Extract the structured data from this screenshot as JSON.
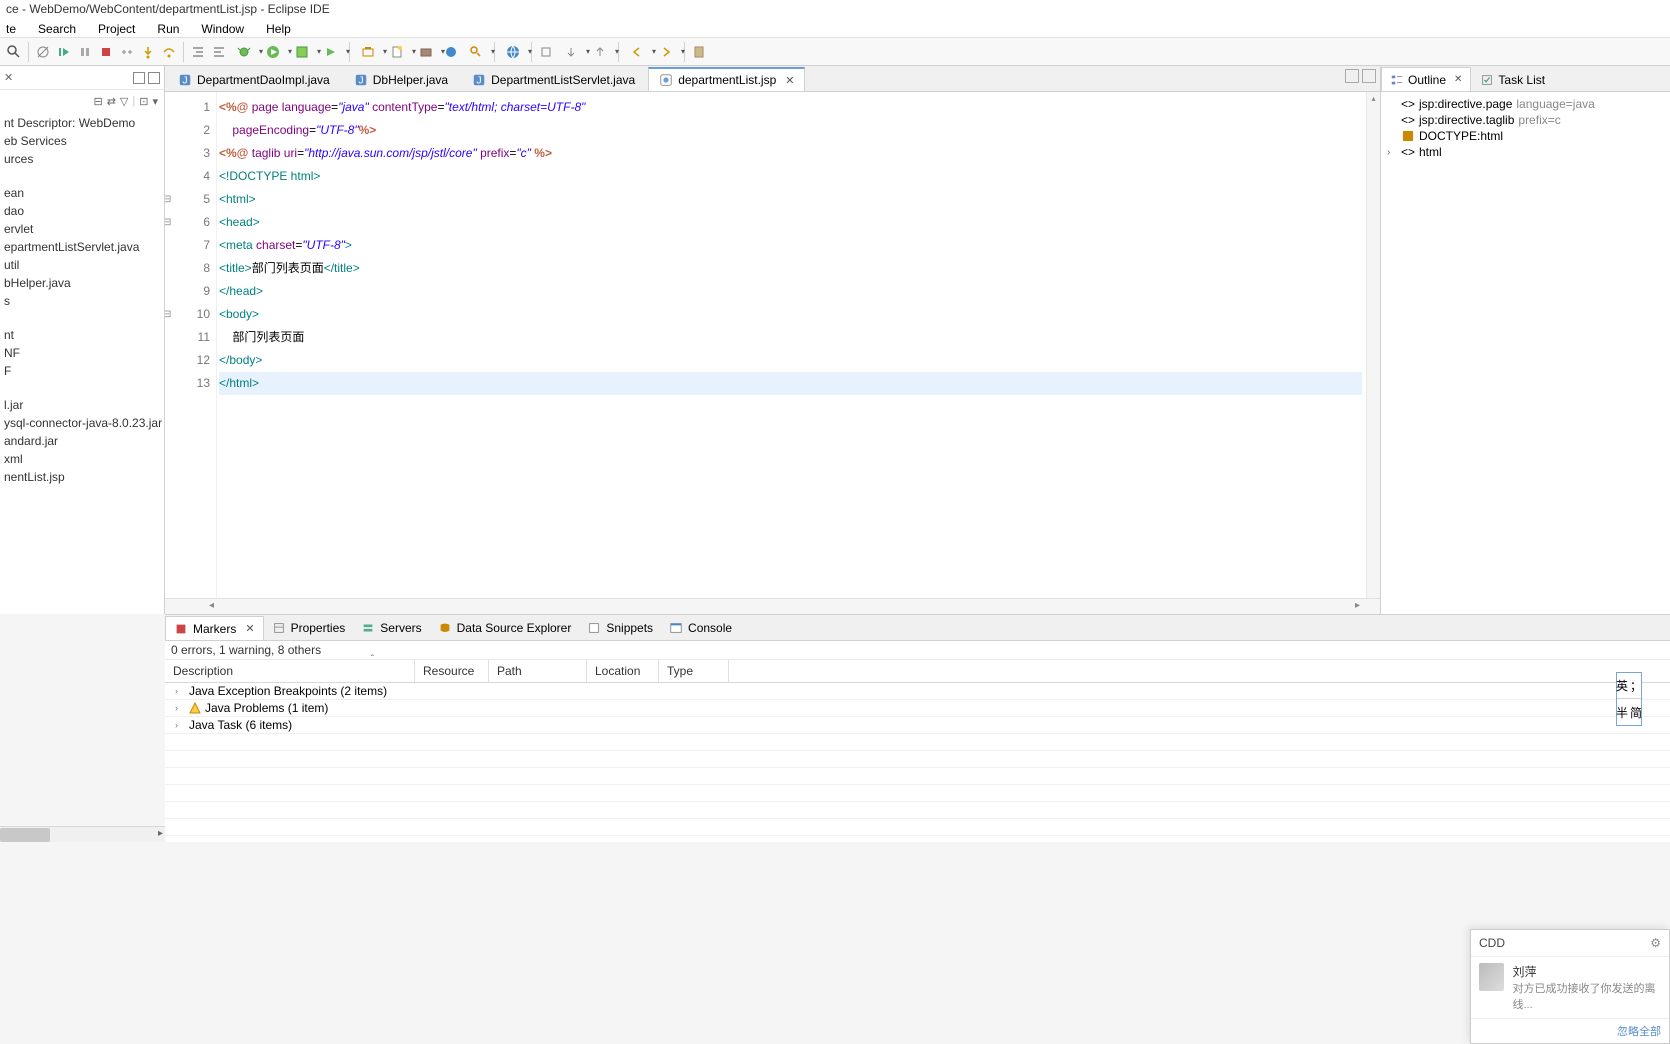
{
  "window": {
    "title": "ce - WebDemo/WebContent/departmentList.jsp - Eclipse IDE"
  },
  "menu": [
    "te",
    "Search",
    "Project",
    "Run",
    "Window",
    "Help"
  ],
  "explorer": {
    "items": [
      "nt Descriptor: WebDemo",
      "eb Services",
      "urces",
      "",
      "ean",
      "dao",
      "ervlet",
      "epartmentListServlet.java",
      "util",
      "bHelper.java",
      "s",
      "",
      "nt",
      "NF",
      "F",
      "",
      "l.jar",
      "ysql-connector-java-8.0.23.jar",
      "andard.jar",
      "xml",
      "nentList.jsp"
    ]
  },
  "tabs": [
    {
      "label": "DepartmentDaoImpl.java",
      "type": "java"
    },
    {
      "label": "DbHelper.java",
      "type": "java"
    },
    {
      "label": "DepartmentListServlet.java",
      "type": "java"
    },
    {
      "label": "departmentList.jsp",
      "type": "jsp",
      "active": true
    }
  ],
  "code": {
    "lines": 13
  },
  "outline": {
    "tab1": "Outline",
    "tab2": "Task List",
    "items": [
      {
        "label": "jsp:directive.page",
        "attr": "language=java"
      },
      {
        "label": "jsp:directive.taglib",
        "attr": "prefix=c"
      },
      {
        "label": "DOCTYPE:html",
        "doctype": true
      },
      {
        "label": "html",
        "expandable": true
      }
    ]
  },
  "bottom": {
    "tabs": [
      "Markers",
      "Properties",
      "Servers",
      "Data Source Explorer",
      "Snippets",
      "Console"
    ],
    "status": "0 errors, 1 warning, 8 others",
    "headers": [
      "Description",
      "Resource",
      "Path",
      "Location",
      "Type"
    ],
    "rows": [
      {
        "label": "Java Exception Breakpoints (2 items)"
      },
      {
        "label": "Java Problems (1 item)",
        "warn": true
      },
      {
        "label": "Java Task (6 items)"
      }
    ]
  },
  "ime": {
    "r1a": "英",
    "r1b": "；",
    "r2a": "半",
    "r2b": "简"
  },
  "notif": {
    "title": "CDD",
    "name": "刘萍",
    "sub": "对方已成功接收了你发送的离线...",
    "foot": "忽略全部"
  }
}
